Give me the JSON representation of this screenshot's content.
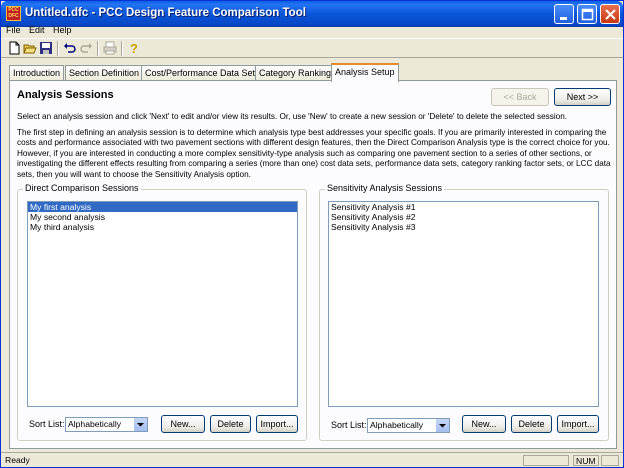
{
  "window": {
    "title": "Untitled.dfc - PCC Design Feature Comparison Tool",
    "app_icon_text": "PCC DFC",
    "title_color": "#0a56d8"
  },
  "menu": [
    "File",
    "Edit",
    "Help"
  ],
  "toolbar": {
    "icons": [
      "new-file-icon",
      "open-folder-icon",
      "save-disk-icon",
      "undo-icon",
      "redo-icon",
      "print-icon",
      "help-icon"
    ]
  },
  "tabs": [
    {
      "label": "Introduction",
      "active": false
    },
    {
      "label": "Section Definition",
      "active": false
    },
    {
      "label": "Cost/Performance Data Sets",
      "active": false
    },
    {
      "label": "Category Rankings",
      "active": false
    },
    {
      "label": "Analysis Setup",
      "active": true
    }
  ],
  "page": {
    "title": "Analysis Sessions",
    "back_label": "<< Back",
    "next_label": "Next >>",
    "intro": "Select an analysis session and click 'Next' to edit and/or view its results.  Or, use 'New' to create a new session or 'Delete' to delete the selected session.",
    "body": "The first step in defining an analysis session is to determine which analysis type best addresses your specific goals.  If you are primarily interested in comparing the costs and performance associated with two pavement sections with different design features, then the Direct Comparison Analysis type is the correct choice for you.  However, if you are interested in conducting a more complex sensitivity-type analysis such as comparing one pavement section to a series of other sections, or investigating the different effects resulting from comparing a series (more than one) cost data sets, performance data sets, category ranking factor sets, or LCC data sets, then you will want to choose the Sensitivity Analysis option."
  },
  "direct": {
    "label": "Direct Comparison Sessions",
    "items": [
      "My first analysis",
      "My second analysis",
      "My third analysis"
    ],
    "selected": 0,
    "sort_label": "Sort List:",
    "sort_value": "Alphabetically",
    "new_label": "New...",
    "delete_label": "Delete",
    "import_label": "Import..."
  },
  "sensitivity": {
    "label": "Sensitivity Analysis Sessions",
    "items": [
      "Sensitivity Analysis #1",
      "Sensitivity Analysis #2",
      "Sensitivity Analysis #3"
    ],
    "sort_label": "Sort List:",
    "sort_value": "Alphabetically",
    "new_label": "New...",
    "delete_label": "Delete",
    "import_label": "Import..."
  },
  "status": {
    "text": "Ready",
    "num": "NUM"
  }
}
